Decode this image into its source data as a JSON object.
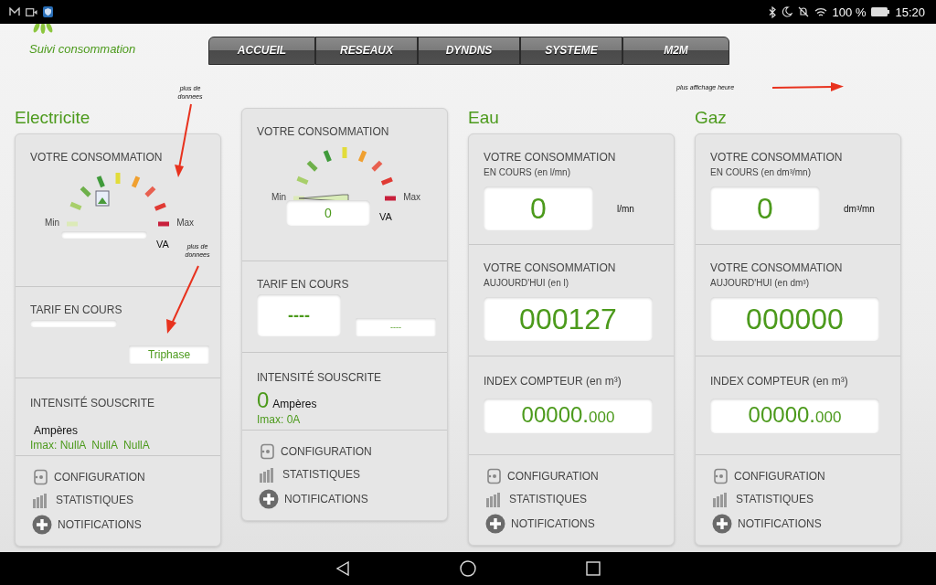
{
  "status_bar": {
    "battery": "100 %",
    "time": "15:20"
  },
  "header": {
    "app_name": "Suivi consommation"
  },
  "tabs": [
    {
      "label": "ACCUEIL",
      "selected": false
    },
    {
      "label": "RESEAUX",
      "selected": false
    },
    {
      "label": "DYNDNS",
      "selected": false
    },
    {
      "label": "SYSTEME",
      "selected": false
    },
    {
      "label": "M2M",
      "selected": false
    }
  ],
  "annotations": [
    "plus de donnees",
    "plus de donnees",
    "plus affichage heure"
  ],
  "meters": [
    {
      "title": "Electricite",
      "sections": [
        {
          "kind": "gauge",
          "label": "VOTRE CONSOMMATION",
          "min_label": "Min",
          "max_label": "Max",
          "needle_shown": false,
          "unit": "VA"
        },
        {
          "kind": "tarif",
          "label": "TARIF EN COURS",
          "fields": [
            {
              "kind": "bar"
            },
            {
              "kind": "small",
              "value": "Triphase"
            }
          ]
        },
        {
          "kind": "intensity",
          "label": "INTENSITÉ SOUSCRITE",
          "unit": "Ampères",
          "imax": "Imax: NullA  NullA  NullA"
        }
      ],
      "links": [
        {
          "kind": "config",
          "label": "CONFIGURATION"
        },
        {
          "kind": "stats",
          "label": "STATISTIQUES"
        },
        {
          "kind": "notify",
          "label": "NOTIFICATIONS"
        }
      ]
    },
    {
      "sections": [
        {
          "kind": "gauge",
          "label": "VOTRE CONSOMMATION",
          "min_label": "Min",
          "max_label": "Max",
          "needle_shown": true,
          "value": "0",
          "unit": "VA"
        },
        {
          "kind": "tarif",
          "label": "TARIF EN COURS",
          "fields": [
            {
              "kind": "large",
              "value": "----"
            },
            {
              "kind": "small",
              "value": "----"
            }
          ]
        },
        {
          "kind": "intensity",
          "label": "INTENSITÉ SOUSCRITE",
          "value": "0",
          "unit": "Ampères",
          "imax": "Imax: 0A"
        }
      ],
      "links": [
        {
          "kind": "config",
          "label": "CONFIGURATION"
        },
        {
          "kind": "stats",
          "label": "STATISTIQUES"
        },
        {
          "kind": "notify",
          "label": "NOTIFICATIONS"
        }
      ]
    },
    {
      "title": "Eau",
      "sections": [
        {
          "kind": "rate",
          "label": "VOTRE CONSOMMATION",
          "sublabel": "EN COURS (en l/mn)",
          "value": "0",
          "unit": "l/mn"
        },
        {
          "kind": "total",
          "label": "VOTRE CONSOMMATION",
          "sublabel": "AUJOURD'HUI (en l)",
          "value": "000127"
        },
        {
          "kind": "index",
          "label": "INDEX COMPTEUR (en m³)",
          "value": "00000.",
          "fraction": "000"
        }
      ],
      "links": [
        {
          "kind": "config",
          "label": "CONFIGURATION"
        },
        {
          "kind": "stats",
          "label": "STATISTIQUES"
        },
        {
          "kind": "notify",
          "label": "NOTIFICATIONS"
        }
      ]
    },
    {
      "title": "Gaz",
      "sections": [
        {
          "kind": "rate",
          "label": "VOTRE CONSOMMATION",
          "sublabel": "EN COURS (en dm³/mn)",
          "value": "0",
          "unit": "dm³/mn"
        },
        {
          "kind": "total",
          "label": "VOTRE CONSOMMATION",
          "sublabel": "AUJOURD'HUI (en dm³)",
          "value": "000000"
        },
        {
          "kind": "index",
          "label": "INDEX COMPTEUR (en m³)",
          "value": "00000.",
          "fraction": "000"
        }
      ],
      "links": [
        {
          "kind": "config",
          "label": "CONFIGURATION"
        },
        {
          "kind": "stats",
          "label": "STATISTIQUES"
        },
        {
          "kind": "notify",
          "label": "NOTIFICATIONS"
        }
      ]
    }
  ]
}
